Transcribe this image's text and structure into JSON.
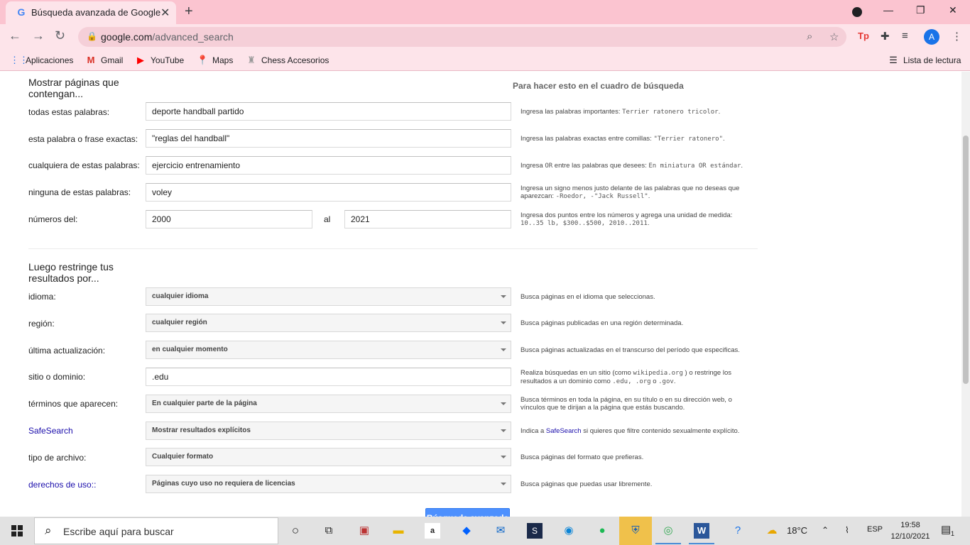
{
  "browser": {
    "tab_title": "Búsqueda avanzada de Google",
    "url_host": "google.com",
    "url_path": "/advanced_search",
    "avatar_letter": "A",
    "reading_list": "Lista de lectura",
    "ext_tp": "Tp"
  },
  "bookmarks": [
    {
      "label": "Aplicaciones",
      "icon": "apps-grid-icon"
    },
    {
      "label": "Gmail",
      "icon": "gmail-icon"
    },
    {
      "label": "YouTube",
      "icon": "youtube-icon"
    },
    {
      "label": "Maps",
      "icon": "maps-pin-icon"
    },
    {
      "label": "Chess Accesorios",
      "icon": "chess-icon"
    }
  ],
  "section1": {
    "title": "Mostrar páginas que contengan...",
    "hint_head": "Para hacer esto en el cuadro de búsqueda"
  },
  "rows1": {
    "all_words": {
      "label": "todas estas palabras:",
      "value": "deporte handball partido"
    },
    "exact": {
      "label": "esta palabra o frase exactas:",
      "value": "\"reglas del handball\""
    },
    "any": {
      "label": "cualquiera de estas palabras:",
      "value": "ejercicio entrenamiento"
    },
    "none": {
      "label": "ninguna de estas palabras:",
      "value": "voley"
    },
    "range": {
      "label": "números del:",
      "from": "2000",
      "to_label": "al",
      "to": "2021"
    }
  },
  "hints1": {
    "all_words_a": "Ingresa las palabras importantes: ",
    "all_words_b": "Terrier ratonero tricolor",
    "all_words_c": ".",
    "exact_a": "Ingresa las palabras exactas entre comillas: ",
    "exact_b": "\"Terrier ratonero\"",
    "exact_c": ".",
    "any_a": "Ingresa ",
    "any_b": "OR",
    "any_c": " entre las palabras que desees: ",
    "any_d": "En miniatura OR estándar",
    "any_e": ".",
    "none_a": "Ingresa un signo menos justo delante de las palabras que no deseas que aparezcan: ",
    "none_b": "-Roedor, -\"Jack Russell\"",
    "none_c": ".",
    "range_a": "Ingresa dos puntos entre los números y agrega una unidad de medida: ",
    "range_b": "10..35 lb, $300..$500, 2010..2011",
    "range_c": "."
  },
  "section2": {
    "title": "Luego restringe tus resultados por..."
  },
  "rows2": {
    "language": {
      "label": "idioma:",
      "value": "cualquier idioma",
      "hint": "Busca páginas en el idioma que seleccionas."
    },
    "region": {
      "label": "región:",
      "value": "cualquier región",
      "hint": "Busca páginas publicadas en una región determinada."
    },
    "updated": {
      "label": "última actualización:",
      "value": "en cualquier momento",
      "hint": "Busca páginas actualizadas en el transcurso del período que especificas."
    },
    "site": {
      "label": "sitio o dominio:",
      "value": ".edu"
    },
    "terms": {
      "label": "términos que aparecen:",
      "value": "En cualquier parte de la página",
      "hint": "Busca términos en toda la página, en su título o en su dirección web, o vínculos que te dirijan a la página que estás buscando."
    },
    "safesearch": {
      "label": "SafeSearch",
      "value": "Mostrar resultados explícitos"
    },
    "filetype": {
      "label": "tipo de archivo:",
      "value": "Cualquier formato",
      "hint": "Busca páginas del formato que prefieras."
    },
    "rights": {
      "label": "derechos de uso::",
      "value": "Páginas cuyo uso no requiera de licencias",
      "hint": "Busca páginas que puedas usar libremente."
    }
  },
  "hints2": {
    "site_a": "Realiza búsquedas en un sitio (como ",
    "site_b": "wikipedia.org",
    "site_c": " ) o restringe los resultados a un dominio como ",
    "site_d": ".edu, .org",
    "site_e": " o ",
    "site_f": ".gov",
    "site_g": ".",
    "safe_a": "Indica a ",
    "safe_b": "SafeSearch",
    "safe_c": " si quieres que filtre contenido sexualmente explícito."
  },
  "submit_label": "Búsqueda avanzada",
  "taskbar": {
    "search_placeholder": "Escribe aquí para buscar",
    "temperature": "18°C",
    "lang": "ESP",
    "time": "19:58",
    "date": "12/10/2021",
    "notif_count": "1"
  }
}
